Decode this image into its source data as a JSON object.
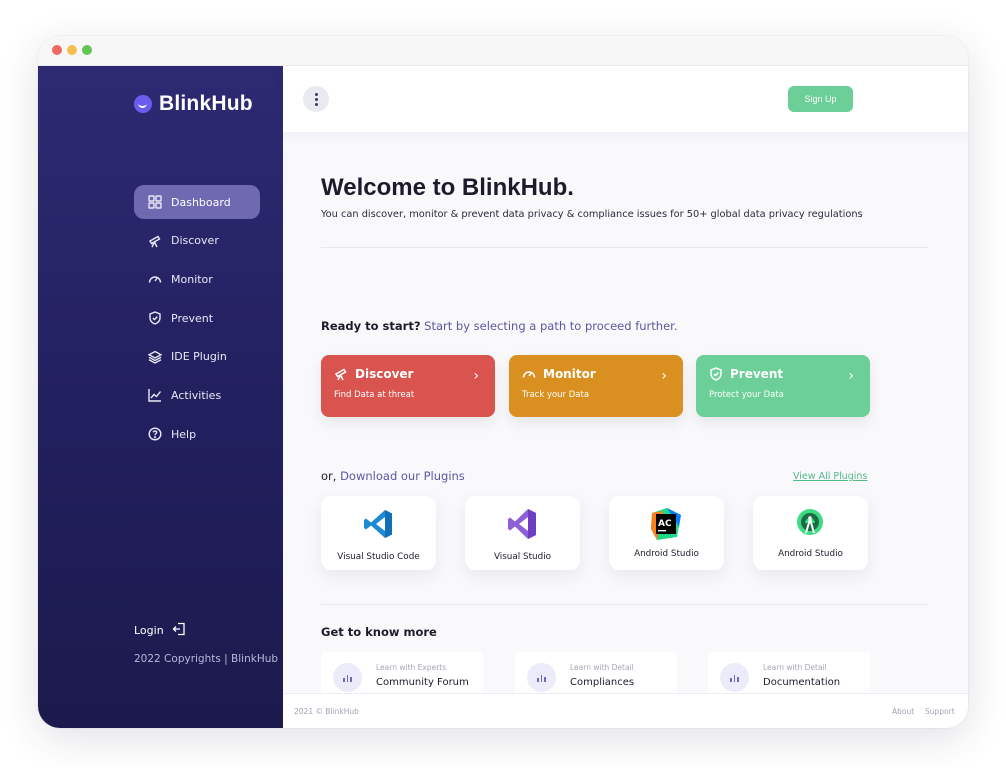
{
  "brand": {
    "name": "BlinkHub"
  },
  "sidebar": {
    "items": [
      {
        "label": "Dashboard",
        "icon": "grid-icon"
      },
      {
        "label": "Discover",
        "icon": "telescope-icon"
      },
      {
        "label": "Monitor",
        "icon": "gauge-icon"
      },
      {
        "label": "Prevent",
        "icon": "shield-check-icon"
      },
      {
        "label": "IDE Plugin",
        "icon": "layers-icon"
      },
      {
        "label": "Activities",
        "icon": "chart-line-icon"
      },
      {
        "label": "Help",
        "icon": "help-circle-icon"
      }
    ],
    "active_index": 0,
    "login": "Login",
    "copyright": "2022 Copyrights | BlinkHub"
  },
  "topbar": {
    "signup": "Sign Up"
  },
  "welcome": {
    "title": "Welcome to BlinkHub.",
    "subtitle": "You can discover, monitor & prevent data privacy & compliance issues for 50+ global data privacy regulations"
  },
  "ready": {
    "bold": "Ready to start?",
    "rest": "Start by selecting a path to proceed further."
  },
  "paths": [
    {
      "title": "Discover",
      "subtitle": "Find Data at threat",
      "color": "#d9534f",
      "icon": "telescope-icon"
    },
    {
      "title": "Monitor",
      "subtitle": "Track your Data",
      "color": "#d99020",
      "icon": "gauge-icon"
    },
    {
      "title": "Prevent",
      "subtitle": "Protect your Data",
      "color": "#6ccf98",
      "icon": "shield-check-icon"
    }
  ],
  "plugins": {
    "prefix": "or,",
    "label": "Download our Plugins",
    "view_all": "View All Plugins",
    "items": [
      {
        "name": "Visual Studio Code",
        "icon": "vscode-icon"
      },
      {
        "name": "Visual Studio",
        "icon": "visual-studio-icon"
      },
      {
        "name": "Android Studio",
        "icon": "appcode-icon",
        "icon_text": "AC"
      },
      {
        "name": "Android Studio",
        "icon": "android-studio-icon"
      }
    ]
  },
  "know_more": {
    "title": "Get to know more",
    "items": [
      {
        "small": "Learn with Experts",
        "title": "Community Forum"
      },
      {
        "small": "Learn with Detail",
        "title": "Compliances"
      },
      {
        "small": "Learn with Detail",
        "title": "Documentation"
      }
    ]
  },
  "footer": {
    "left": "2021 © BlinkHub",
    "about": "About",
    "support": "Support"
  },
  "colors": {
    "sidebar": "#231f60",
    "active": "#6e69b0",
    "accent_green": "#6ccf98",
    "link_muted": "#5a56a0"
  }
}
